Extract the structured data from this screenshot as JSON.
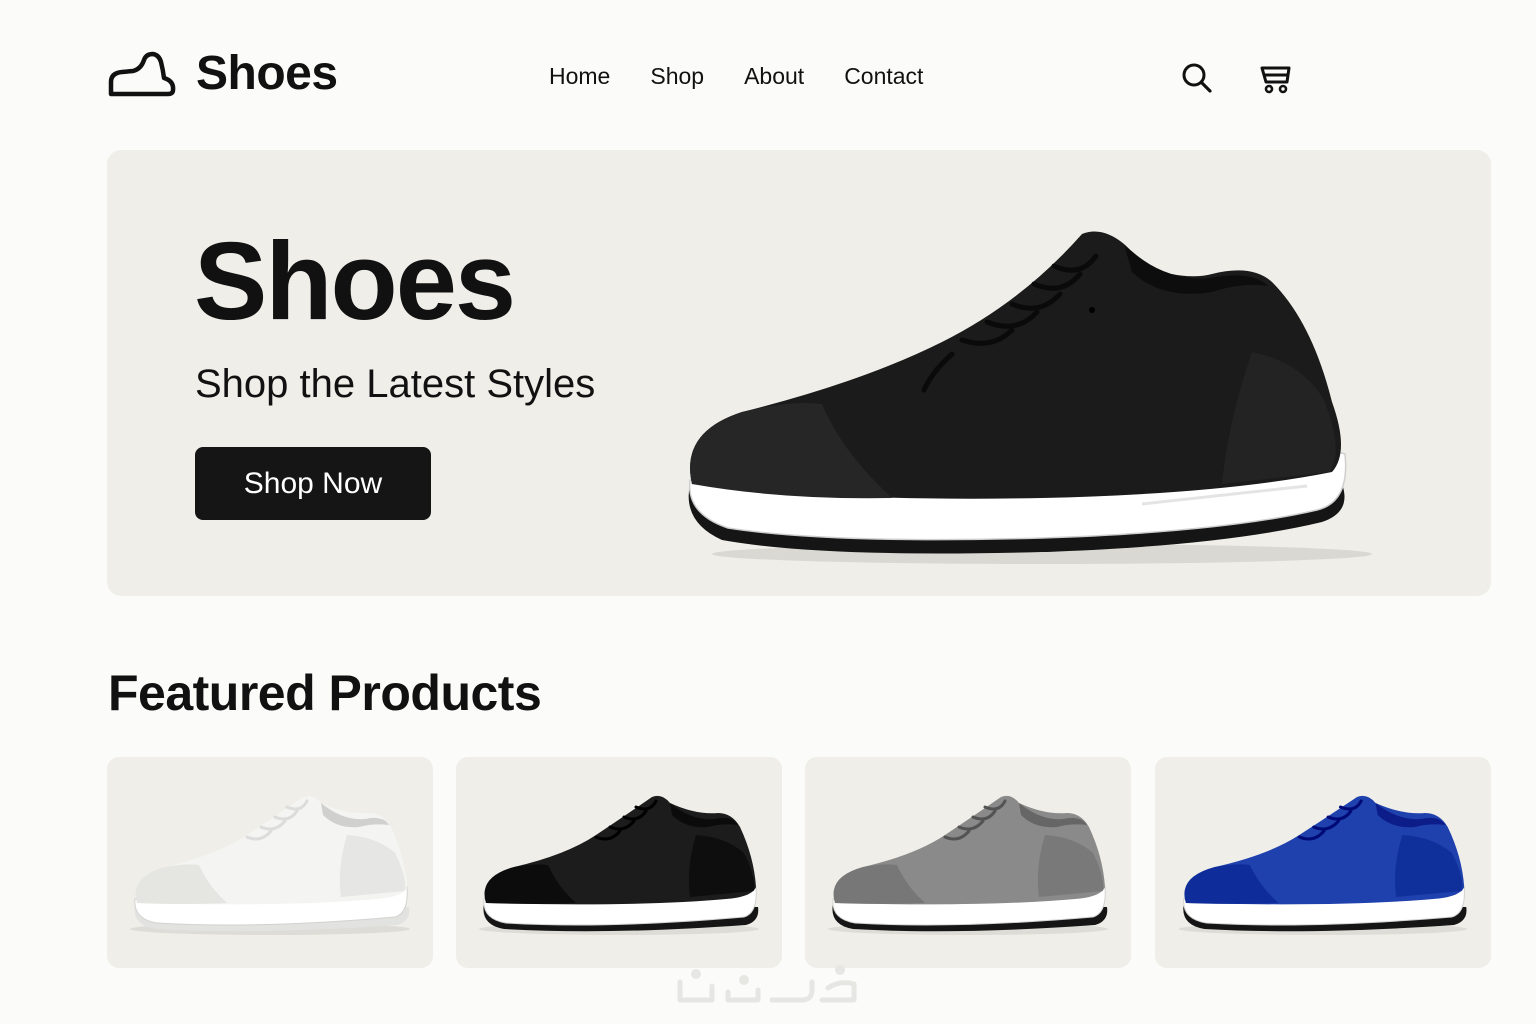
{
  "brand": {
    "name": "Shoes",
    "logo_icon": "shoe-icon"
  },
  "nav": {
    "items": [
      {
        "label": "Home"
      },
      {
        "label": "Shop"
      },
      {
        "label": "About"
      },
      {
        "label": "Contact"
      }
    ]
  },
  "header_icons": {
    "search": "search-icon",
    "cart": "cart-icon"
  },
  "hero": {
    "title": "Shoes",
    "subtitle": "Shop the Latest Styles",
    "cta_label": "Shop Now",
    "shoe_color": "#1b1b1b"
  },
  "featured": {
    "title": "Featured Products",
    "products": [
      {
        "color_name": "white",
        "color": "#f4f4f2"
      },
      {
        "color_name": "black",
        "color": "#1c1c1c"
      },
      {
        "color_name": "gray",
        "color": "#8a8a8a"
      },
      {
        "color_name": "blue",
        "color": "#1f41ad"
      }
    ]
  },
  "colors": {
    "background": "#fbfbfa",
    "panel": "#efeee9",
    "text": "#111111",
    "button": "#151515"
  }
}
